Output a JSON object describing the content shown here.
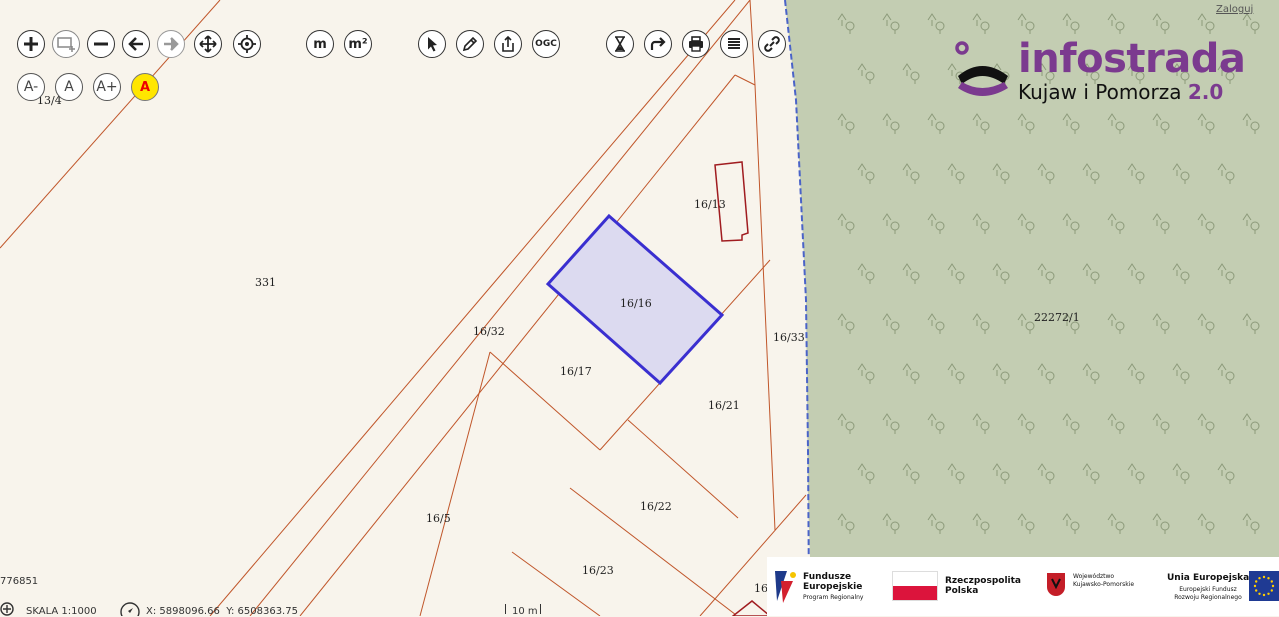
{
  "map": {
    "parcels": [
      {
        "label": "13/4"
      },
      {
        "label": "331"
      },
      {
        "label": "16/13"
      },
      {
        "label": "16/16"
      },
      {
        "label": "16/32"
      },
      {
        "label": "16/33"
      },
      {
        "label": "16/17"
      },
      {
        "label": "16/21"
      },
      {
        "label": "22272/1"
      },
      {
        "label": "16/22"
      },
      {
        "label": "16/5"
      },
      {
        "label": "16/23"
      },
      {
        "label": "16"
      }
    ],
    "selected_parcel_color": "#3a2fd0",
    "forest_color": "#c3cdb2",
    "boundary_color": "#c0562a",
    "left_coord": "776851"
  },
  "toolbar": {
    "row1": [
      {
        "name": "zoom-in",
        "icon": "plus-icon"
      },
      {
        "name": "zoom-box",
        "icon": "zoom-rect-icon"
      },
      {
        "name": "zoom-out",
        "icon": "minus-icon"
      },
      {
        "name": "back",
        "icon": "arrow-left-icon"
      },
      {
        "name": "forward",
        "icon": "arrow-right-icon"
      },
      {
        "name": "pan",
        "icon": "move-icon"
      },
      {
        "name": "locate",
        "icon": "target-icon"
      },
      {
        "name": "measure-length",
        "label": "m"
      },
      {
        "name": "measure-area",
        "label": "m²"
      },
      {
        "name": "select",
        "icon": "pointer-icon"
      },
      {
        "name": "edit",
        "icon": "pencil-icon"
      },
      {
        "name": "export",
        "icon": "share-icon"
      },
      {
        "name": "ogc",
        "label": "OGC"
      },
      {
        "name": "hourglass",
        "icon": "hourglass-icon"
      },
      {
        "name": "redirect",
        "icon": "redirect-arrow-icon"
      },
      {
        "name": "print",
        "icon": "printer-icon"
      },
      {
        "name": "layers",
        "icon": "layers-icon"
      },
      {
        "name": "link",
        "icon": "link-icon"
      }
    ],
    "row2": [
      {
        "name": "font-smaller",
        "label": "A-"
      },
      {
        "name": "font-normal",
        "label": "A"
      },
      {
        "name": "font-larger",
        "label": "A+"
      },
      {
        "name": "font-contrast",
        "label": "A"
      }
    ]
  },
  "logo": {
    "brand": "infostrada",
    "subtitle": "Kujaw i Pomorza",
    "version": "2.0"
  },
  "login_label": "Zaloguj",
  "status": {
    "scale": "SKALA 1:1000",
    "coords": "X: 5898096.66  Y: 6508363.75",
    "scalebar": "10 m"
  },
  "eu_bar": {
    "fe_title": "Fundusze Europejskie",
    "fe_sub": "Program Regionalny",
    "rp": "Rzeczpospolita Polska",
    "woj": "Województwo Kujawsko-Pomorskie",
    "ue_title": "Unia Europejska",
    "ue_sub": "Europejski Fundusz Rozwoju Regionalnego"
  }
}
